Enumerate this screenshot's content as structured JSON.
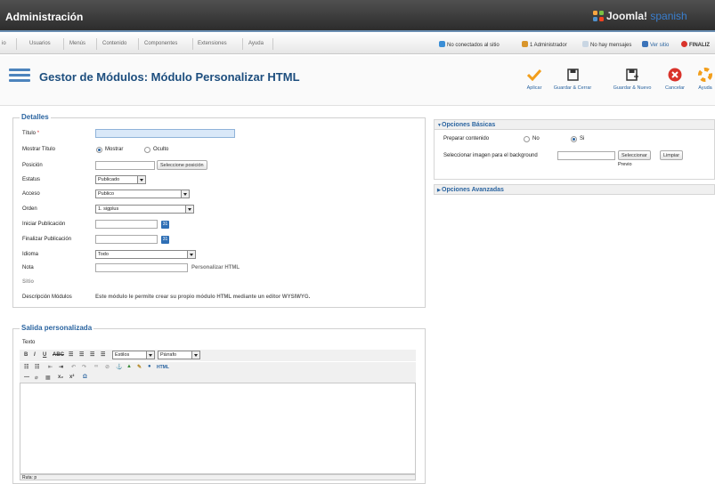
{
  "topbar": {
    "title": "Administración",
    "logo_text": "Joomla!",
    "logo_suffix": "spanish"
  },
  "menu": [
    "io",
    "Usuarios",
    "Menús",
    "Contenido",
    "Componentes",
    "Extensiones",
    "Ayuda"
  ],
  "status": {
    "offline": "No conectados al sitio",
    "admins": "1 Administrador",
    "messages": "No hay mensajes",
    "view_site": "Ver sitio",
    "logout": "FINALIZ"
  },
  "header": {
    "title": "Gestor de Módulos: Módulo Personalizar HTML"
  },
  "toolbar": {
    "apply": "Aplicar",
    "save_close": "Guardar & Cerrar",
    "save_new": "Guardar & Nuevo",
    "cancel": "Cancelar",
    "help": "Ayuda"
  },
  "details": {
    "legend": "Detalles",
    "title_label": "Título",
    "title_required": "*",
    "title_value": "",
    "show_title_label": "Mostrar Título",
    "show_option": "Mostrar",
    "hide_option": "Oculto",
    "position_label": "Posición",
    "position_value": "",
    "position_button": "Seleccione posición",
    "status_label": "Estatus",
    "status_value": "Publicado",
    "access_label": "Acceso",
    "access_value": "Publico",
    "order_label": "Orden",
    "order_value": "1. sigplus",
    "start_label": "Iniciar Publicación",
    "finish_label": "Finalizar Publicación",
    "language_label": "Idioma",
    "language_value": "Todo",
    "note_label": "Nota",
    "module_name": "Personalizar HTML",
    "site_label": "Sitio",
    "desc_label": "Descripción Módulos",
    "desc_text": "Este módulo le permite crear su propio módulo HTML mediante un editor WYSIWYG.",
    "calendar_glyph": "31"
  },
  "custom_output": {
    "legend": "Salida personalizada",
    "text_label": "Texto",
    "styles_value": "Estilos",
    "format_value": "Párrafo",
    "path_label": "Ruta: p"
  },
  "basic_options": {
    "header": "Opciones Básicas",
    "prepare_label": "Preparar contenido",
    "no_option": "No",
    "yes_option": "Si",
    "bg_label": "Seleccionar imagen para el background",
    "select_button": "Seleccionar",
    "clear_button": "Limpiar",
    "preview_label": "Previo"
  },
  "advanced_options": {
    "header": "Opciones Avanzadas"
  },
  "colors": {
    "accent": "#2a64a0",
    "title": "#1d4e7e",
    "apply": "#f29e1b",
    "cancel": "#d9332b"
  },
  "icons": [
    "joomla-logo",
    "check-icon",
    "save-icon",
    "save-new-icon",
    "cancel-icon",
    "help-icon",
    "calendar-icon",
    "module-page-icon"
  ]
}
